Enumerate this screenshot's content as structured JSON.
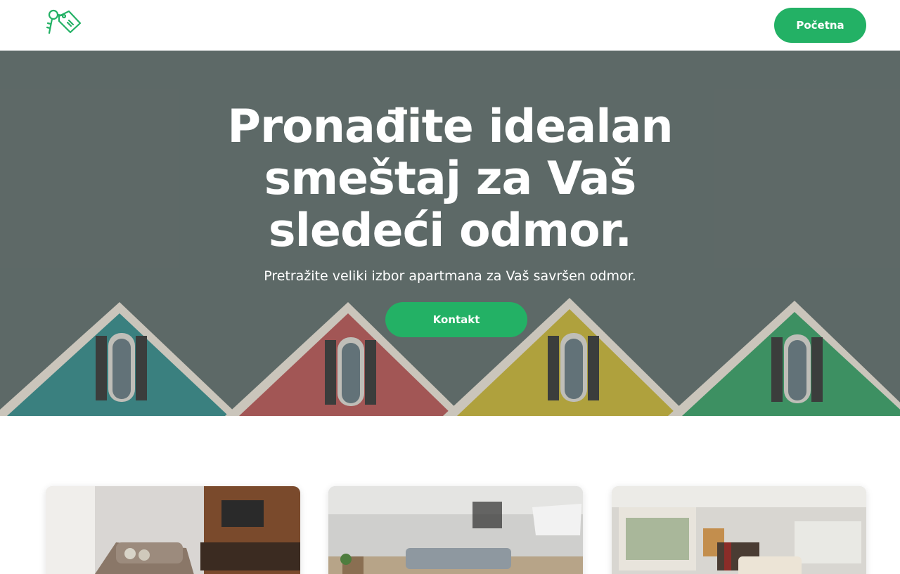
{
  "header": {
    "logo_icon": "keys-tag-icon",
    "nav_button_label": "Početna"
  },
  "hero": {
    "title_line1": "Pronađite idealan",
    "title_line2": "smeštaj za Vaš",
    "title_line3": "sledeći odmor.",
    "subtitle": "Pretražite veliki izbor apartmana za Vaš savršen odmor.",
    "cta_label": "Kontakt",
    "roof_colors": [
      "#3a8d8d",
      "#b95a5a",
      "#c9b53c",
      "#3ea06a"
    ]
  },
  "colors": {
    "accent": "#23b165",
    "hero_bg": "#6a7673"
  },
  "cards": [
    {
      "image": "living-room-wood-wall-photo"
    },
    {
      "image": "living-room-bright-photo"
    },
    {
      "image": "open-plan-living-room-photo"
    }
  ]
}
